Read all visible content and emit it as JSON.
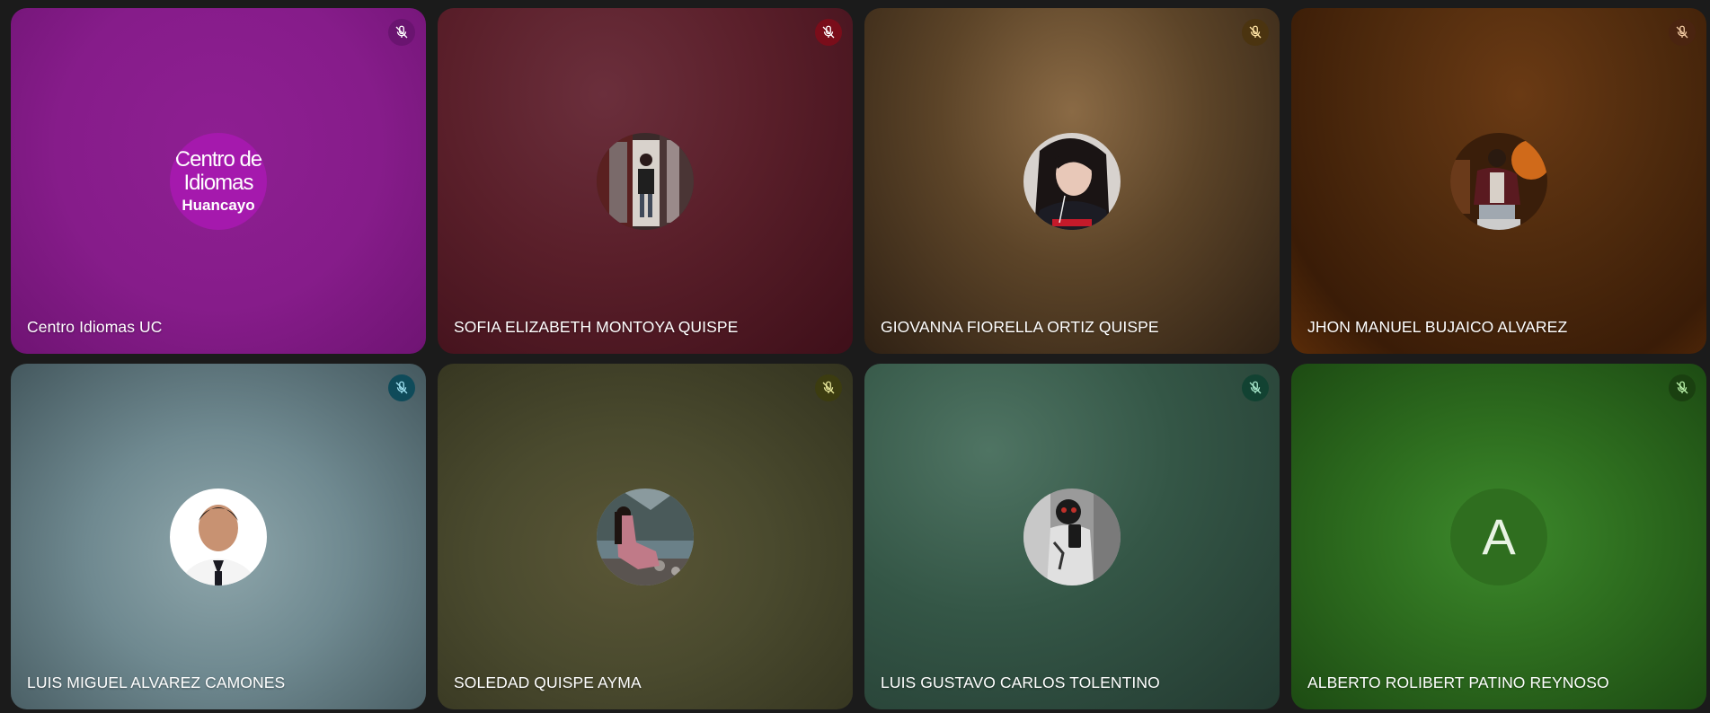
{
  "participants": [
    {
      "name": "Centro Idiomas UC",
      "logo": {
        "line1": "Centro de",
        "line2": "Idiomas",
        "line3": "Huancayo"
      },
      "mic_color": "#6a1470",
      "icon": "mic-off-icon"
    },
    {
      "name": "SOFIA ELIZABETH MONTOYA QUISPE",
      "mic_color": "#7a0d1a",
      "icon": "mic-off-icon"
    },
    {
      "name": "GIOVANNA FIORELLA ORTIZ QUISPE",
      "mic_color": "#4b3410",
      "icon": "mic-off-icon"
    },
    {
      "name": "JHON MANUEL BUJAICO ALVAREZ",
      "mic_color": "#4a2410",
      "icon": "mic-off-icon"
    },
    {
      "name": "LUIS MIGUEL ALVAREZ CAMONES",
      "mic_color": "#0f4b5a",
      "icon": "mic-off-icon"
    },
    {
      "name": "SOLEDAD QUISPE AYMA",
      "mic_color": "#3c3c10",
      "icon": "mic-off-icon"
    },
    {
      "name": "LUIS GUSTAVO CARLOS TOLENTINO",
      "mic_color": "#124232",
      "icon": "mic-off-icon"
    },
    {
      "name": "ALBERTO ROLIBERT PATINO REYNOSO",
      "initial": "A",
      "mic_color": "#1a4010",
      "icon": "mic-off-icon"
    }
  ]
}
